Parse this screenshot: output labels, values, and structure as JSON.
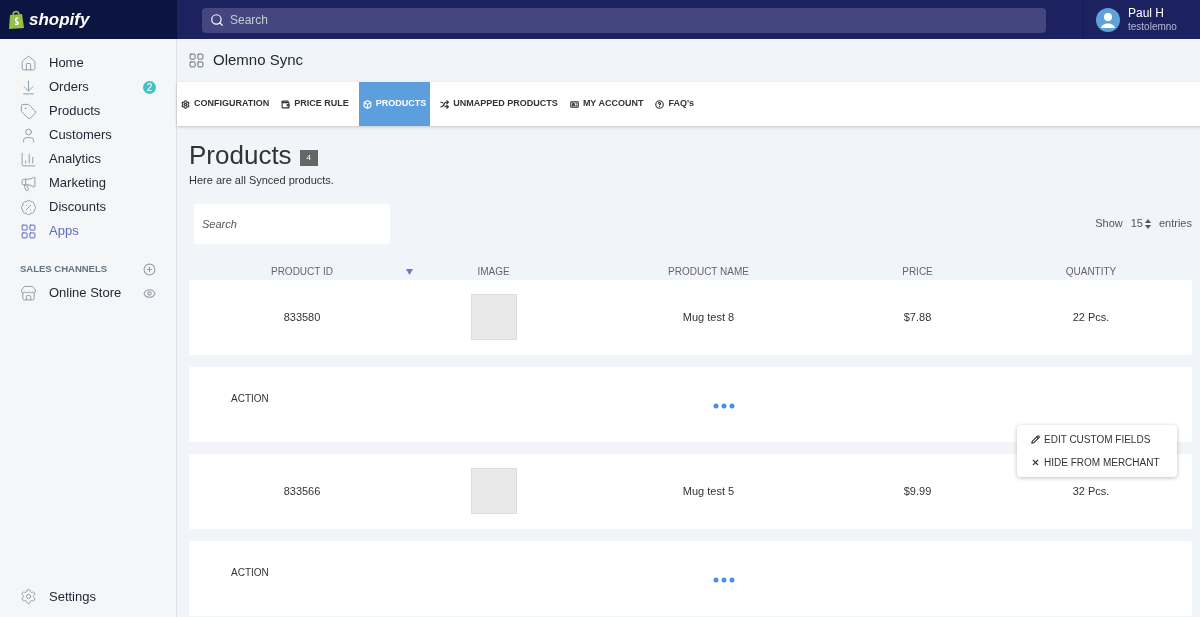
{
  "topbar": {
    "logo": "shopify",
    "search": {
      "placeholder": "Search"
    },
    "user": {
      "name": "Paul H",
      "store": "testolemno"
    }
  },
  "sidebar": {
    "items": [
      {
        "kind": "home",
        "label": "Home",
        "selected": false
      },
      {
        "kind": "orders",
        "label": "Orders",
        "selected": false,
        "badge": "2"
      },
      {
        "kind": "products",
        "label": "Products",
        "selected": false
      },
      {
        "kind": "customers",
        "label": "Customers",
        "selected": false
      },
      {
        "kind": "analytics",
        "label": "Analytics",
        "selected": false
      },
      {
        "kind": "marketing",
        "label": "Marketing",
        "selected": false
      },
      {
        "kind": "discounts",
        "label": "Discounts",
        "selected": false
      },
      {
        "kind": "apps",
        "label": "Apps",
        "selected": true
      }
    ],
    "section": "SALES CHANNELS",
    "channels": [
      {
        "kind": "store",
        "label": "Online Store",
        "selected": false
      }
    ],
    "settings": "Settings"
  },
  "app": {
    "title": "Olemno Sync",
    "tabs": [
      {
        "kind": "config",
        "label": "CONFIGURATION",
        "selected": false
      },
      {
        "kind": "price",
        "label": "PRICE RULE",
        "selected": false
      },
      {
        "kind": "products",
        "label": "PRODUCTS",
        "selected": true
      },
      {
        "kind": "unmapped",
        "label": "UNMAPPED PRODUCTS",
        "selected": false
      },
      {
        "kind": "account",
        "label": "MY ACCOUNT",
        "selected": false
      },
      {
        "kind": "faq",
        "label": "FAQ's",
        "selected": false
      }
    ],
    "heading": "Products",
    "count": "4",
    "subtitle": "Here are all Synced products.",
    "search": {
      "placeholder": "Search"
    },
    "show": {
      "before": "Show",
      "value": "15",
      "after": "entries"
    },
    "table": {
      "columns": [
        "PRODUCT ID",
        "IMAGE",
        "PRODUCT NAME",
        "PRICE",
        "QUANTITY"
      ],
      "rows": [
        {
          "kind": "product",
          "id": "833580",
          "name": "Mug test 8",
          "price": "$7.88",
          "quantity": "22 Pcs."
        },
        {
          "kind": "action",
          "label": "ACTION"
        },
        {
          "kind": "product",
          "id": "833566",
          "name": "Mug test 5",
          "price": "$9.99",
          "quantity": "32 Pcs."
        },
        {
          "kind": "action",
          "label": "ACTION"
        }
      ]
    },
    "menu": {
      "items": [
        {
          "kind": "edit",
          "label": "EDIT CUSTOM FIELDS"
        },
        {
          "kind": "hide",
          "label": "HIDE FROM MERCHANT"
        }
      ]
    }
  }
}
